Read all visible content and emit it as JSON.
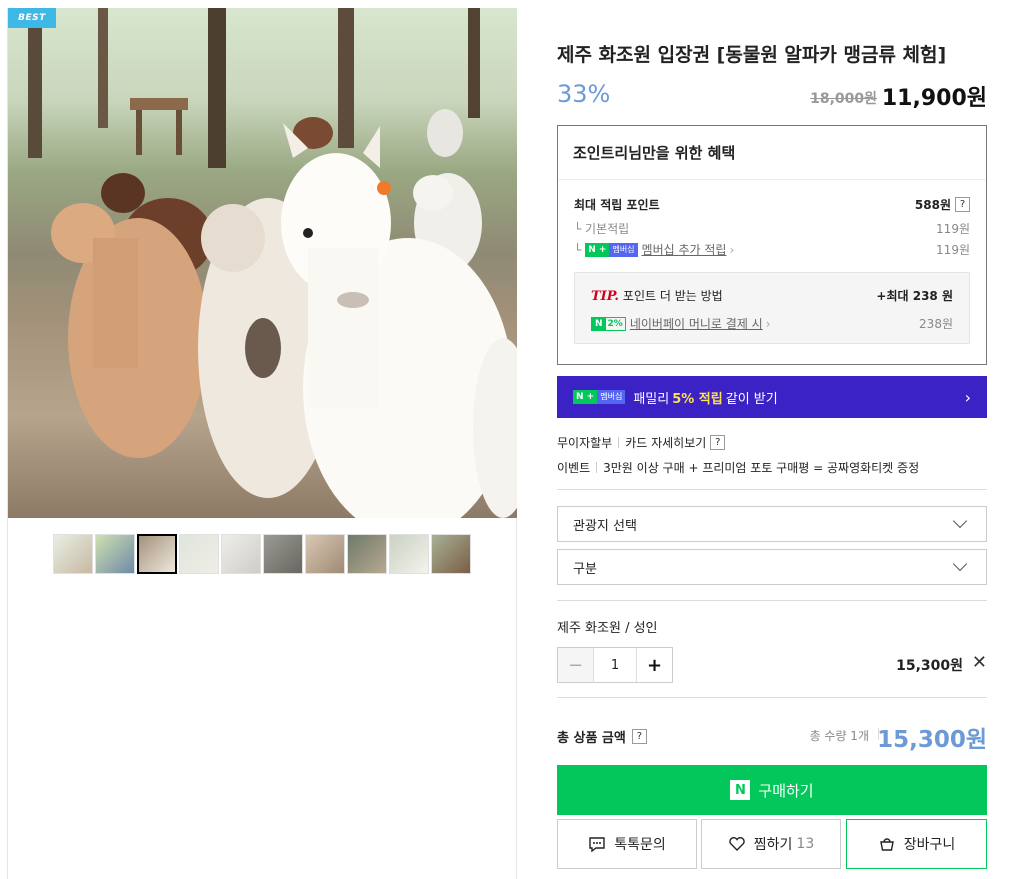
{
  "gallery": {
    "badge": "BEST",
    "thumbnail_count": 10,
    "active_thumbnail_index": 2
  },
  "product": {
    "title": "제주 화조원 입장권 [동물원 알파카 맹금류 체험]",
    "discount": "33%",
    "original_price": "18,000원",
    "sale_price": "11,900원"
  },
  "benefits": {
    "heading": "조인트리님만을 위한 혜택",
    "max_points_label": "최대 적립 포인트",
    "max_points_value": "588원",
    "base_label": "기본적립",
    "base_value": "119원",
    "membership_tag_n": "N +",
    "membership_tag": "멤버십",
    "membership_link": "멤버십 추가 적립",
    "membership_value": "119원",
    "tip_label": "TIP.",
    "tip_text": "포인트 더 받는 방법",
    "tip_max": "+최대 238 원",
    "npay_tag_n": "N",
    "npay_tag_pct": "2%",
    "npay_link": "네이버페이 머니로 결제 시",
    "npay_value": "238원"
  },
  "family_banner": {
    "tag_n": "N +",
    "tag": "멤버십",
    "text_pre": "패밀리",
    "highlight": "5% 적립",
    "text_post": "같이 받기",
    "chevron": "›"
  },
  "payment_info": {
    "installment": "무이자할부",
    "card_details": "카드 자세히보기",
    "event_label": "이벤트",
    "event_text": "3만원 이상 구매 + 프리미엄 포토 구매평 = 공짜영화티켓 증정"
  },
  "options": {
    "select1_label": "관광지 선택",
    "select2_label": "구분",
    "selected_option": "제주 화조원 / 성인",
    "quantity": "1",
    "minus": "−",
    "plus": "+",
    "option_price": "15,300원",
    "remove": "✕"
  },
  "total": {
    "label": "총 상품 금액",
    "qty_text": "총 수량 1개",
    "amount": "15,300원"
  },
  "actions": {
    "buy_logo": "N",
    "buy_label": "구매하기",
    "talk_label": "톡톡문의",
    "wish_label": "찜하기",
    "wish_count": "13",
    "cart_label": "장바구니"
  },
  "help_mark": "?"
}
